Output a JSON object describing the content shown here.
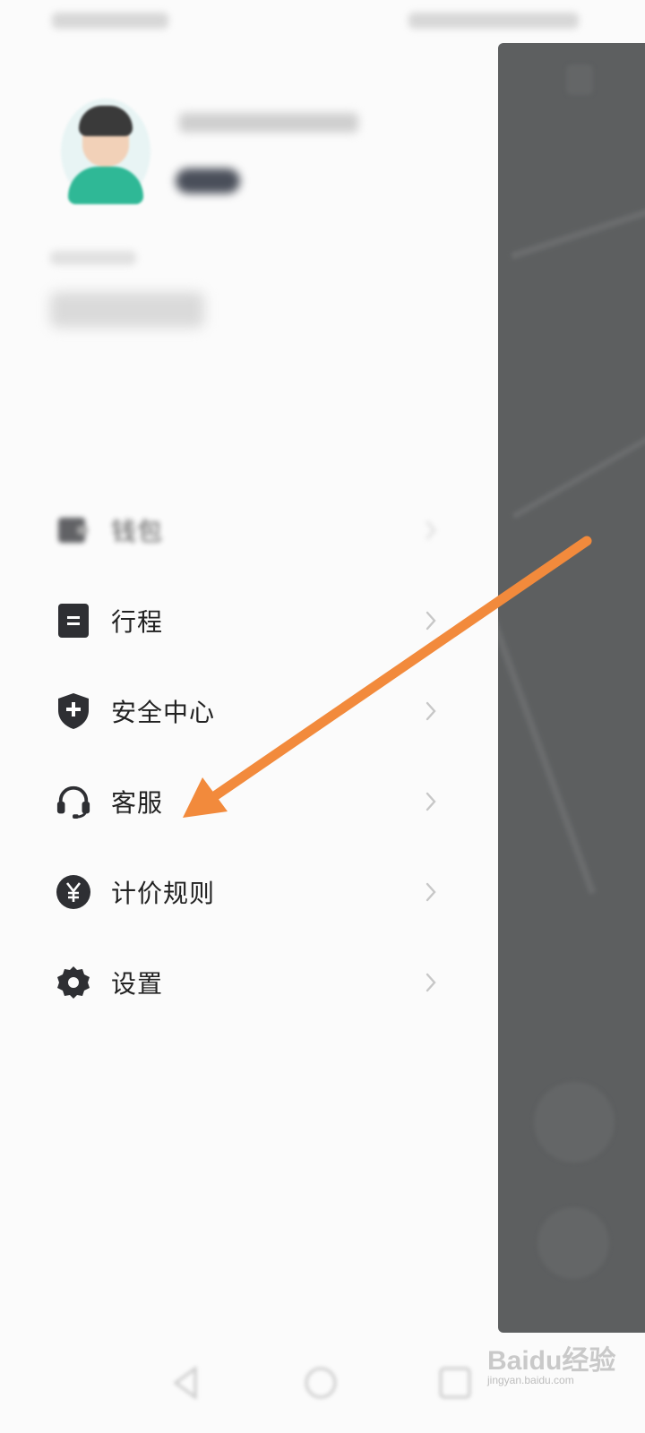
{
  "menu": {
    "items": [
      {
        "id": "wallet",
        "label": "钱包",
        "icon": "wallet-icon"
      },
      {
        "id": "trips",
        "label": "行程",
        "icon": "document-icon"
      },
      {
        "id": "safety",
        "label": "安全中心",
        "icon": "shield-plus-icon"
      },
      {
        "id": "support",
        "label": "客服",
        "icon": "headset-icon"
      },
      {
        "id": "pricing",
        "label": "计价规则",
        "icon": "yen-icon"
      },
      {
        "id": "settings",
        "label": "设置",
        "icon": "gear-icon"
      }
    ]
  },
  "annotation": {
    "color": "#f28a3c",
    "points_to": "support"
  },
  "watermark": {
    "brand": "Baidu经验",
    "url": "jingyan.baidu.com"
  },
  "colors": {
    "icon": "#2e2f33",
    "overlay": "#5d5f60",
    "chevron": "#c7c7c7"
  }
}
